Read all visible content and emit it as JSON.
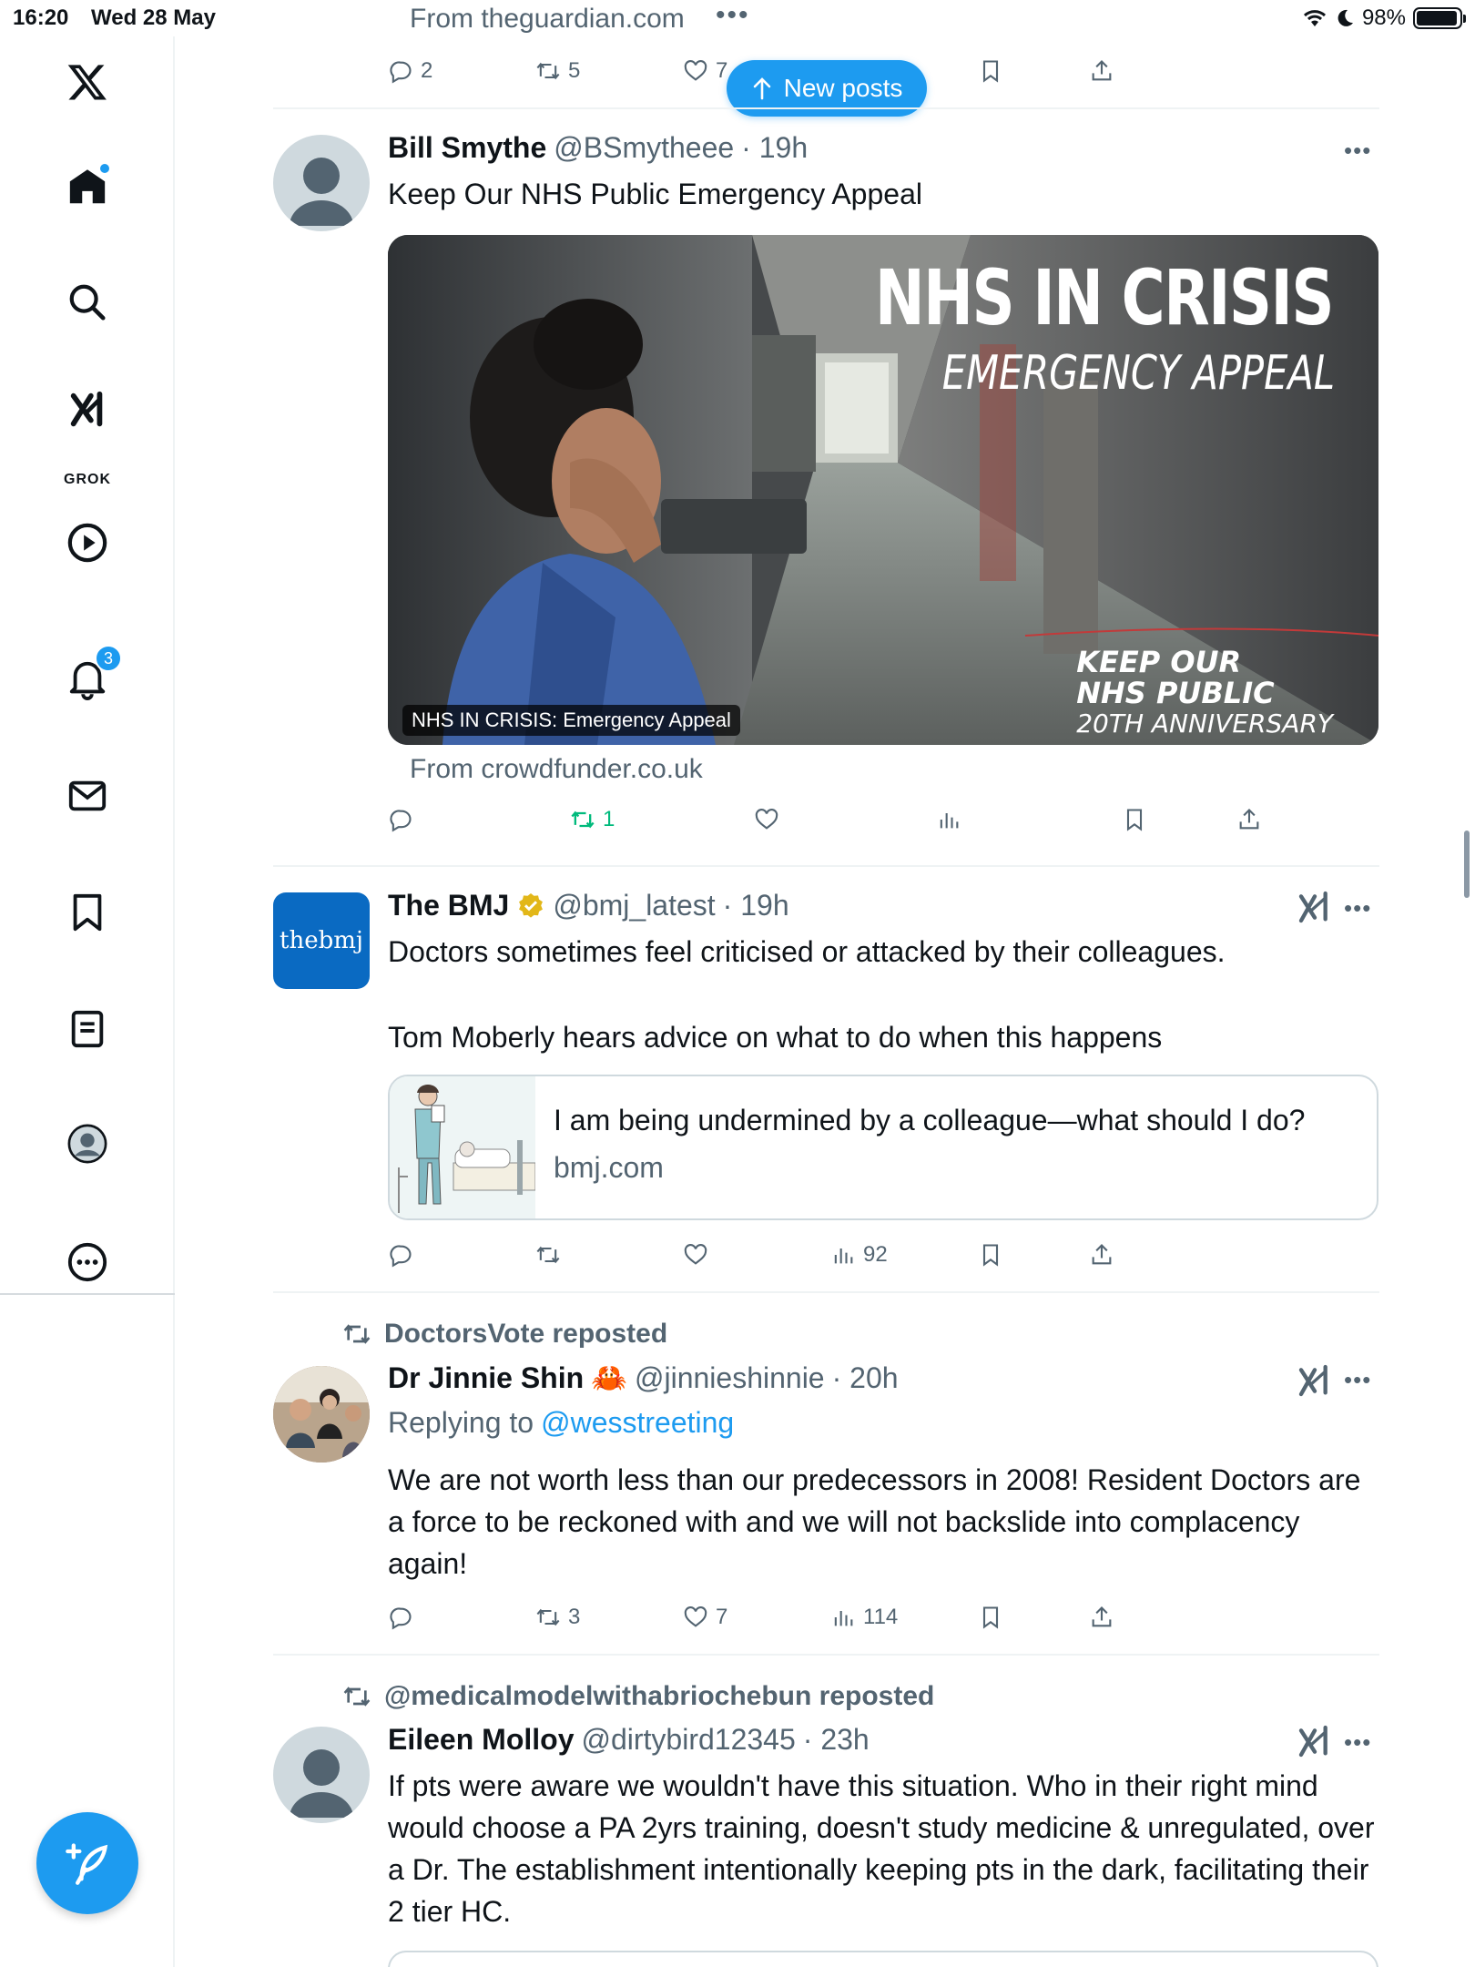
{
  "status_bar": {
    "time": "16:20",
    "date": "Wed 28 May",
    "battery": "98%"
  },
  "sidebar": {
    "notifications_count": "3",
    "grok_label": "GROK"
  },
  "new_posts_label": "New posts",
  "prev_post": {
    "from": "From theguardian.com",
    "replies": "2",
    "reposts": "5",
    "likes": "7"
  },
  "posts": [
    {
      "name": "Bill Smythe",
      "handle": "@BSmytheee",
      "time": "· 19h",
      "text": "Keep Our NHS Public Emergency Appeal",
      "media": {
        "headline": "NHS IN CRISIS",
        "subheadline": "EMERGENCY APPEAL",
        "brand_line1": "KEEP OUR",
        "brand_line2": "NHS PUBLIC",
        "brand_line3": "20TH ANNIVERSARY",
        "caption": "NHS IN CRISIS: Emergency Appeal"
      },
      "from": "From crowdfunder.co.uk",
      "reposts": "1"
    },
    {
      "name": "The BMJ",
      "handle": "@bmj_latest",
      "time": "· 19h",
      "avatar_text": "thebmj",
      "text1": "Doctors sometimes feel criticised or attacked by their colleagues.",
      "text2": "Tom Moberly hears advice on what to do when this happens",
      "card_title": "I am being undermined by a colleague—what should I do?",
      "card_domain": "bmj.com",
      "views": "92"
    },
    {
      "reposted_by": "DoctorsVote reposted",
      "name": "Dr Jinnie Shin",
      "emoji": "🦀",
      "handle": "@jinnieshinnie",
      "time": "· 20h",
      "replying_prefix": "Replying to",
      "replying_to": "@wesstreeting",
      "text": "We are not worth less than our predecessors in 2008! Resident Doctors are a force to be reckoned with and we will not backslide into complacency again!",
      "reposts": "3",
      "likes": "7",
      "views": "114"
    },
    {
      "reposted_by": "@medicalmodelwithabriochebun reposted",
      "name": "Eileen Molloy",
      "handle": "@dirtybird12345",
      "time": "· 23h",
      "text": "If pts were aware we wouldn't have this situation. Who in their right mind would choose a PA 2yrs training, doesn't study medicine & unregulated, over a Dr. The establishment intentionally keeping pts in the dark, facilitating their 2 tier HC."
    }
  ],
  "colors": {
    "accent": "#1d9bf0",
    "muted": "#536471",
    "repost_green": "#00ba7c"
  }
}
